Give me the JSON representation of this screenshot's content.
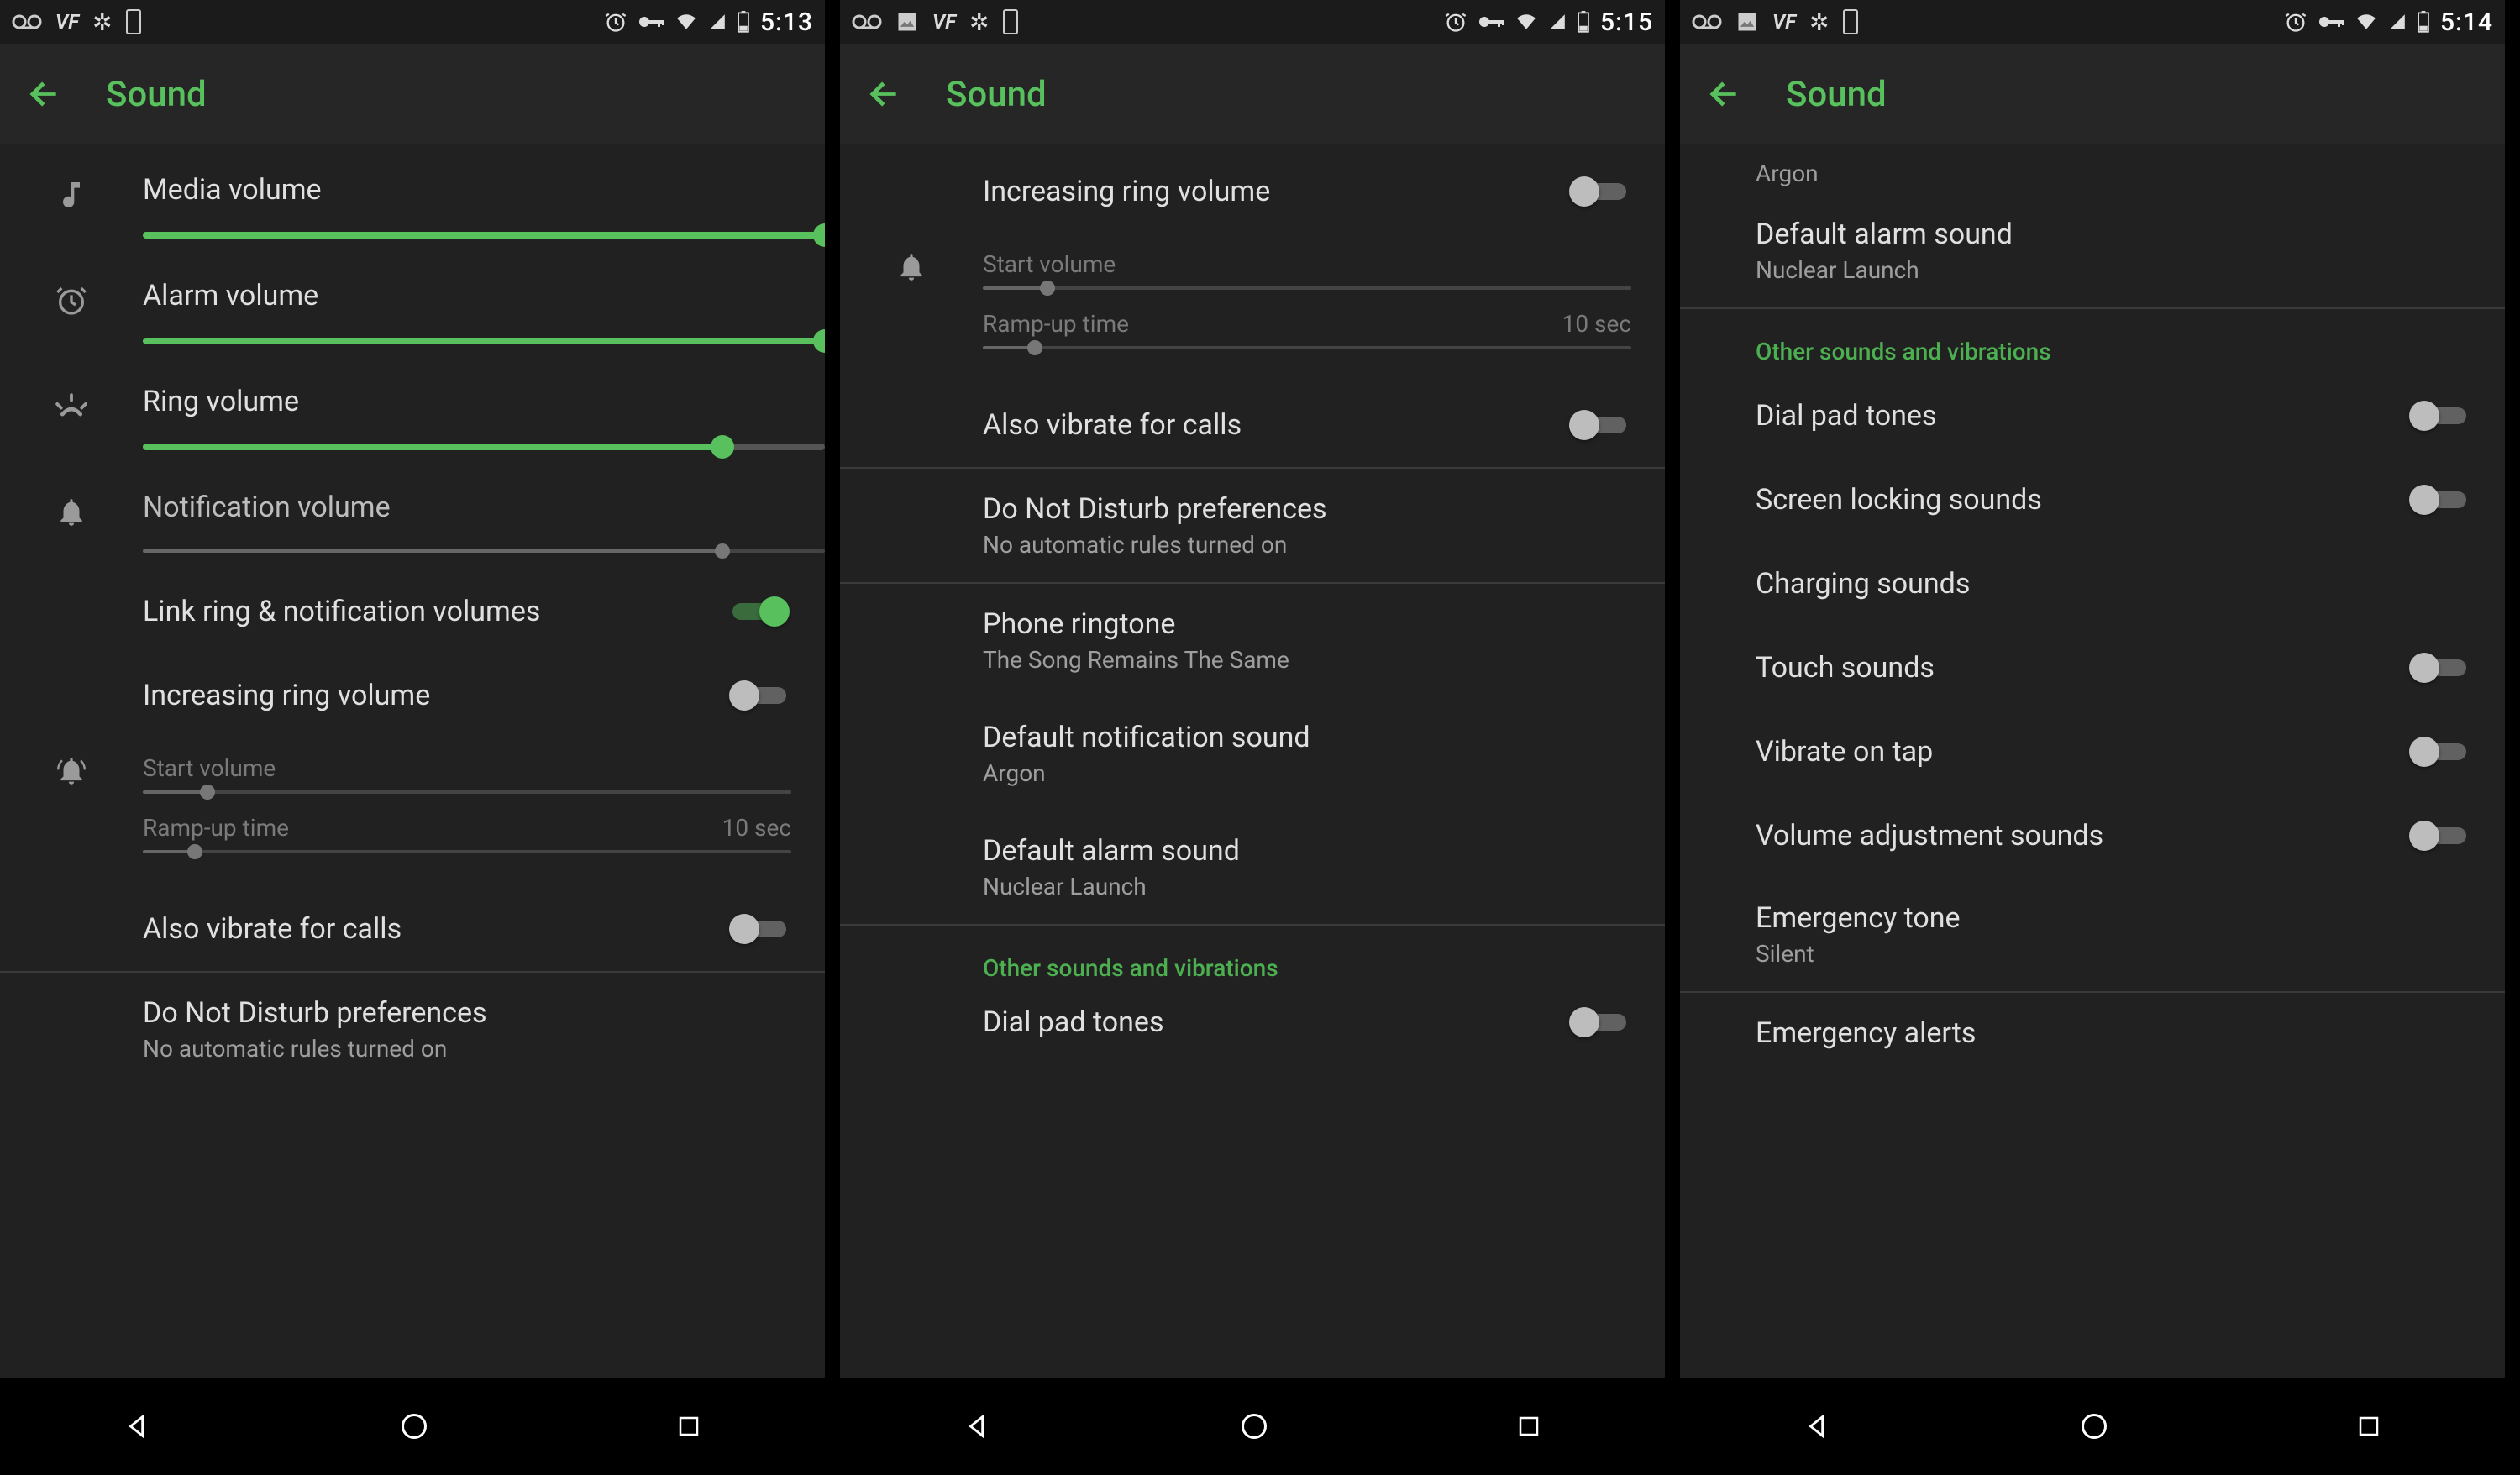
{
  "accent_color": "#4caf50",
  "phone1": {
    "status": {
      "time": "5:13"
    },
    "title": "Sound",
    "media_volume": {
      "label": "Media volume",
      "value": 100
    },
    "alarm_volume": {
      "label": "Alarm volume",
      "value": 100
    },
    "ring_volume": {
      "label": "Ring volume",
      "value": 85
    },
    "notification_volume": {
      "label": "Notification volume",
      "value": 85
    },
    "link_volumes": {
      "label": "Link ring & notification volumes",
      "on": true
    },
    "increasing_ring": {
      "label": "Increasing ring volume",
      "on": false
    },
    "start_volume": {
      "label": "Start volume",
      "value": 10
    },
    "ramp_up": {
      "label": "Ramp-up time",
      "value_text": "10 sec",
      "value": 8
    },
    "also_vibrate": {
      "label": "Also vibrate for calls",
      "on": false
    },
    "dnd": {
      "label": "Do Not Disturb preferences",
      "sub": "No automatic rules turned on"
    }
  },
  "phone2": {
    "status": {
      "time": "5:15"
    },
    "title": "Sound",
    "increasing_ring": {
      "label": "Increasing ring volume",
      "on": false
    },
    "start_volume": {
      "label": "Start volume",
      "value": 10
    },
    "ramp_up": {
      "label": "Ramp-up time",
      "value_text": "10 sec",
      "value": 8
    },
    "also_vibrate": {
      "label": "Also vibrate for calls",
      "on": false
    },
    "dnd": {
      "label": "Do Not Disturb preferences",
      "sub": "No automatic rules turned on"
    },
    "ringtone": {
      "label": "Phone ringtone",
      "sub": "The Song Remains The Same"
    },
    "notif_sound": {
      "label": "Default notification sound",
      "sub": "Argon"
    },
    "alarm_sound": {
      "label": "Default alarm sound",
      "sub": "Nuclear Launch"
    },
    "section": "Other sounds and vibrations",
    "dial_pad": {
      "label": "Dial pad tones",
      "on": false
    }
  },
  "phone3": {
    "status": {
      "time": "5:14"
    },
    "title": "Sound",
    "notif_sound_sub": "Argon",
    "alarm_sound": {
      "label": "Default alarm sound",
      "sub": "Nuclear Launch"
    },
    "section": "Other sounds and vibrations",
    "dial_pad": {
      "label": "Dial pad tones",
      "on": false
    },
    "screen_lock": {
      "label": "Screen locking sounds",
      "on": false
    },
    "charging": {
      "label": "Charging sounds"
    },
    "touch": {
      "label": "Touch sounds",
      "on": false
    },
    "vibrate_tap": {
      "label": "Vibrate on tap",
      "on": false
    },
    "vol_adjust": {
      "label": "Volume adjustment sounds",
      "on": false
    },
    "emergency_tone": {
      "label": "Emergency tone",
      "sub": "Silent"
    },
    "emergency_alerts": {
      "label": "Emergency alerts"
    }
  }
}
